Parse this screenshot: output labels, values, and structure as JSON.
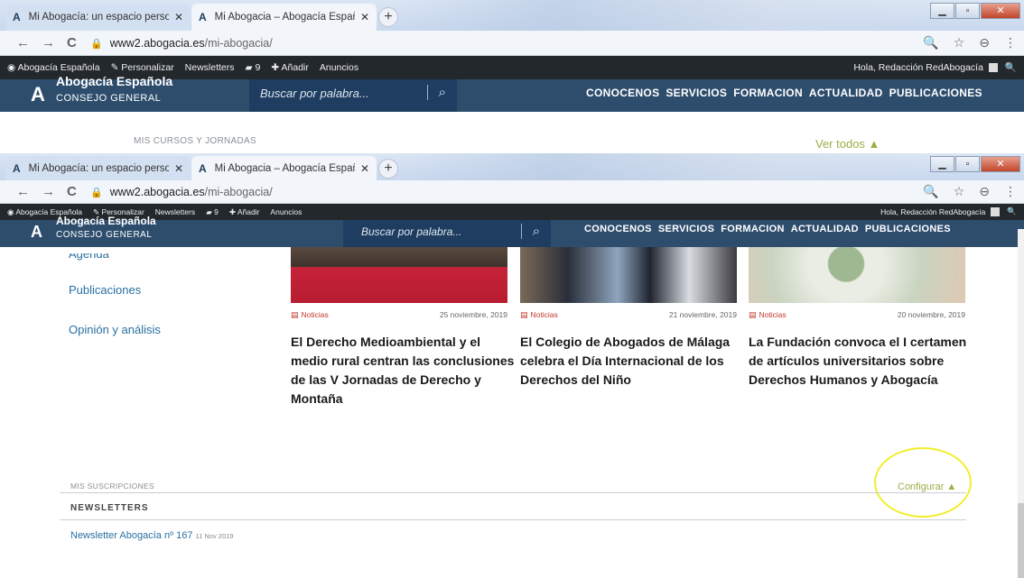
{
  "browser": {
    "tabs": [
      {
        "title": "Mi Abogacía: un espacio persona",
        "active": false
      },
      {
        "title": "Mi Abogacia – Abogacía Español",
        "active": true
      }
    ],
    "favicon": "A",
    "close": "✕",
    "new_tab": "+",
    "url_host": "www2.abogacia.es",
    "url_path": "/mi-abogacia/",
    "icons": {
      "back": "←",
      "forward": "→",
      "reload": "C",
      "lock": "🔒",
      "zoom": "🔍",
      "star": "☆",
      "profile": "⊖",
      "menu": "⋮"
    },
    "window_buttons": {
      "minimize": "▁",
      "maximize": "▫",
      "close": "✕"
    }
  },
  "admin_bar": {
    "site": "Abogacía Española",
    "customize": "Personalizar",
    "newsletters": "Newsletters",
    "comments_count": "9",
    "add": "Añadir",
    "ads": "Anuncios",
    "greeting": "Hola, Redacción RedAbogacía"
  },
  "header": {
    "logo_title": "Abogacía Española",
    "logo_subtitle": "CONSEJO GENERAL",
    "search_placeholder": "Buscar por palabra...",
    "nav": [
      "CONOCENOS",
      "SERVICIOS",
      "FORMACION",
      "ACTUALIDAD",
      "PUBLICACIONES"
    ]
  },
  "top_section": {
    "courses_label": "MIS CURSOS Y JORNADAS",
    "see_all": "Ver todos ▲"
  },
  "sidebar": {
    "items": [
      "Agenda",
      "Publicaciones",
      "Opinión y análisis"
    ]
  },
  "news": [
    {
      "category": "Noticias",
      "date": "25 noviembre, 2019",
      "title": "El Derecho Medioambiental y el medio rural centran las conclusiones de las V Jornadas de Derecho y Montaña"
    },
    {
      "category": "Noticias",
      "date": "21 noviembre, 2019",
      "title": "El Colegio de Abogados de Málaga celebra el Día Internacional de los Derechos del Niño"
    },
    {
      "category": "Noticias",
      "date": "20 noviembre, 2019",
      "title": "La Fundación convoca el I certamen de artículos universitarios sobre Derechos Humanos y Abogacía"
    }
  ],
  "subscriptions": {
    "label": "MIS SUSCRIPCIONES",
    "configure": "Configurar ▲",
    "section": "NEWSLETTERS",
    "items": [
      {
        "name": "Newsletter Abogacía nº 167",
        "date": "11 Nov 2019"
      }
    ]
  },
  "colors": {
    "header": "#2e4d6d",
    "accent": "#9aae45",
    "link": "#2a6fa0",
    "highlight_circle": "#f2ee2c"
  }
}
